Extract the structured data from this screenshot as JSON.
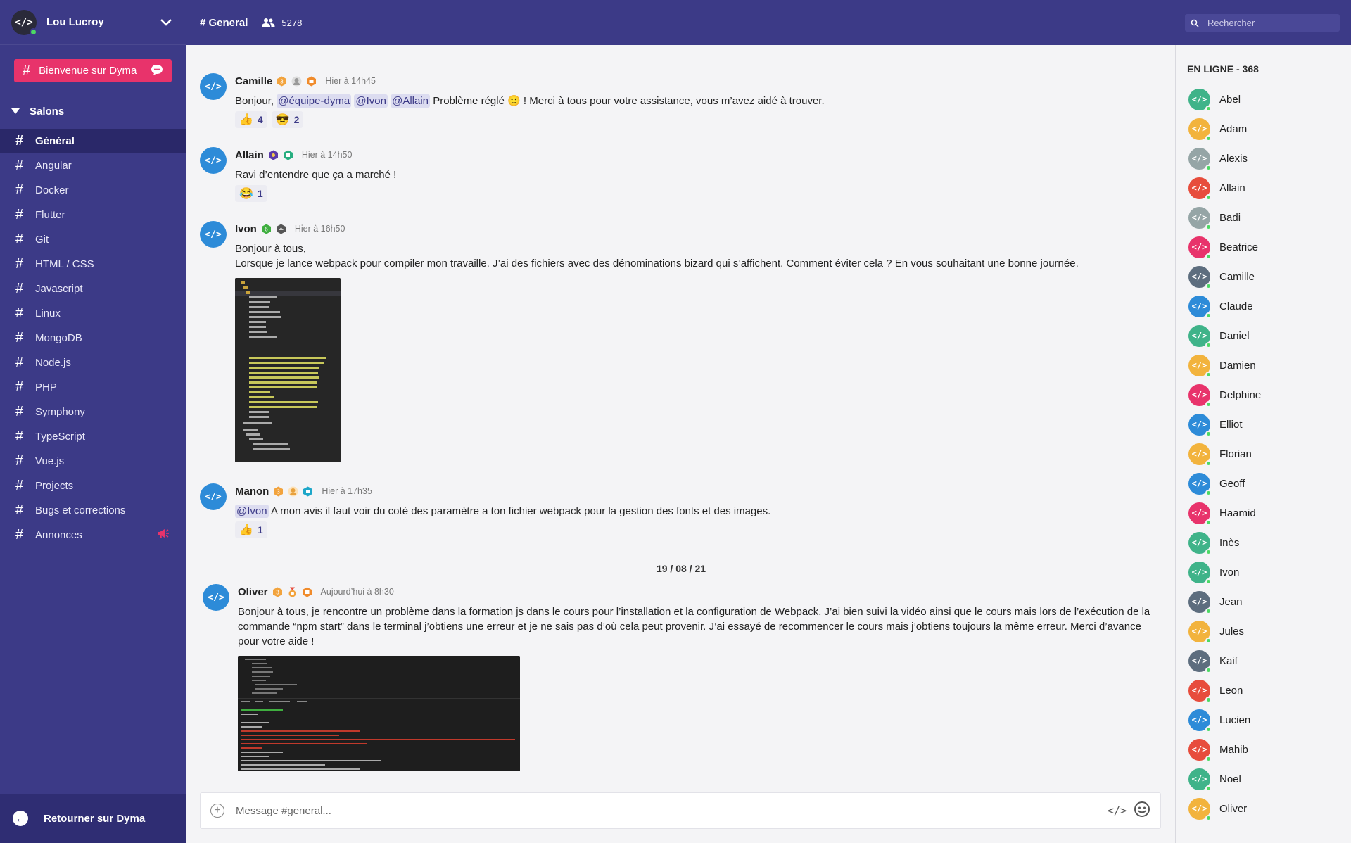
{
  "user": {
    "name": "Lou Lucroy"
  },
  "welcome": {
    "label": "Bienvenue sur Dyma"
  },
  "salons": {
    "title": "Salons",
    "channels": [
      "Général",
      "Angular",
      "Docker",
      "Flutter",
      "Git",
      "HTML / CSS",
      "Javascript",
      "Linux",
      "MongoDB",
      "Node.js",
      "PHP",
      "Symphony",
      "TypeScript",
      "Vue.js",
      "Projects",
      "Bugs et corrections",
      "Annonces"
    ]
  },
  "back": {
    "label": "Retourner sur Dyma"
  },
  "topbar": {
    "channel": "# General",
    "members_count": "5278",
    "search_placeholder": "Rechercher"
  },
  "online": {
    "title": "EN LIGNE - 368",
    "members": [
      {
        "name": "Abel",
        "color": "#3fb389"
      },
      {
        "name": "Adam",
        "color": "#f2b33d"
      },
      {
        "name": "Alexis",
        "color": "#95a5a6"
      },
      {
        "name": "Allain",
        "color": "#e74c3c"
      },
      {
        "name": "Badi",
        "color": "#95a5a6"
      },
      {
        "name": "Beatrice",
        "color": "#e8336b"
      },
      {
        "name": "Camille",
        "color": "#5d6d7e"
      },
      {
        "name": "Claude",
        "color": "#2d8bd8"
      },
      {
        "name": "Daniel",
        "color": "#3fb389"
      },
      {
        "name": "Damien",
        "color": "#f2b33d"
      },
      {
        "name": "Delphine",
        "color": "#e8336b"
      },
      {
        "name": "Elliot",
        "color": "#2d8bd8"
      },
      {
        "name": "Florian",
        "color": "#f2b33d"
      },
      {
        "name": "Geoff",
        "color": "#2d8bd8"
      },
      {
        "name": "Haamid",
        "color": "#e8336b"
      },
      {
        "name": "Inès",
        "color": "#3fb389"
      },
      {
        "name": "Ivon",
        "color": "#3fb389"
      },
      {
        "name": "Jean",
        "color": "#5d6d7e"
      },
      {
        "name": "Jules",
        "color": "#f2b33d"
      },
      {
        "name": "Kaif",
        "color": "#5d6d7e"
      },
      {
        "name": "Leon",
        "color": "#e74c3c"
      },
      {
        "name": "Lucien",
        "color": "#2d8bd8"
      },
      {
        "name": "Mahib",
        "color": "#e74c3c"
      },
      {
        "name": "Noel",
        "color": "#3fb389"
      },
      {
        "name": "Oliver",
        "color": "#f2b33d"
      }
    ]
  },
  "avatar_glyph": "</>",
  "messages": {
    "camille": {
      "author": "Camille",
      "time": "Hier à 14h45",
      "text_pre": "Bonjour,",
      "mentions": [
        "@équipe-dyma",
        "@Ivon",
        "@Allain"
      ],
      "text_post": "Problème réglé 🙂 ! Merci à tous pour votre assistance, vous m’avez aidé à trouver.",
      "reactions": [
        {
          "emoji": "👍",
          "count": "4"
        },
        {
          "emoji": "😎",
          "count": "2"
        }
      ]
    },
    "allain": {
      "author": "Allain",
      "time": "Hier à 14h50",
      "text": "Ravi d’entendre que ça a marché !",
      "reactions": [
        {
          "emoji": "😂",
          "count": "1"
        }
      ]
    },
    "ivon": {
      "author": "Ivon",
      "time": "Hier à 16h50",
      "line1": "Bonjour à tous,",
      "line2": "Lorsque je lance webpack pour compiler mon travaille. J’ai des fichiers avec des dénominations bizard qui s’affichent. Comment éviter cela ? En vous souhaitant une bonne journée."
    },
    "manon": {
      "author": "Manon",
      "time": "Hier à 17h35",
      "mention": "@Ivon",
      "text": "A mon avis il faut voir du coté des paramètre a ton fichier webpack pour la gestion des fonts et des images.",
      "reactions": [
        {
          "emoji": "👍",
          "count": "1"
        }
      ]
    },
    "divider": "19 / 08 / 21",
    "oliver": {
      "author": "Oliver",
      "time": "Aujourd’hui à 8h30",
      "text": "Bonjour à tous, je rencontre un problème dans la formation js dans le cours pour l’installation et la configuration de Webpack. J’ai bien suivi la vidéo ainsi que le cours mais lors de l’exécution de la commande “npm start” dans le terminal j’obtiens une erreur et je ne sais pas d’où cela peut provenir. J’ai essayé de recommencer le cours mais j’obtiens toujours la même erreur. Merci d’avance pour votre aide !"
    }
  },
  "composer": {
    "placeholder": "Message #general...",
    "code_glyph": "</>"
  },
  "colors": {
    "primary": "#3c3a87",
    "accent": "#e8336b",
    "online": "#4cd964"
  }
}
